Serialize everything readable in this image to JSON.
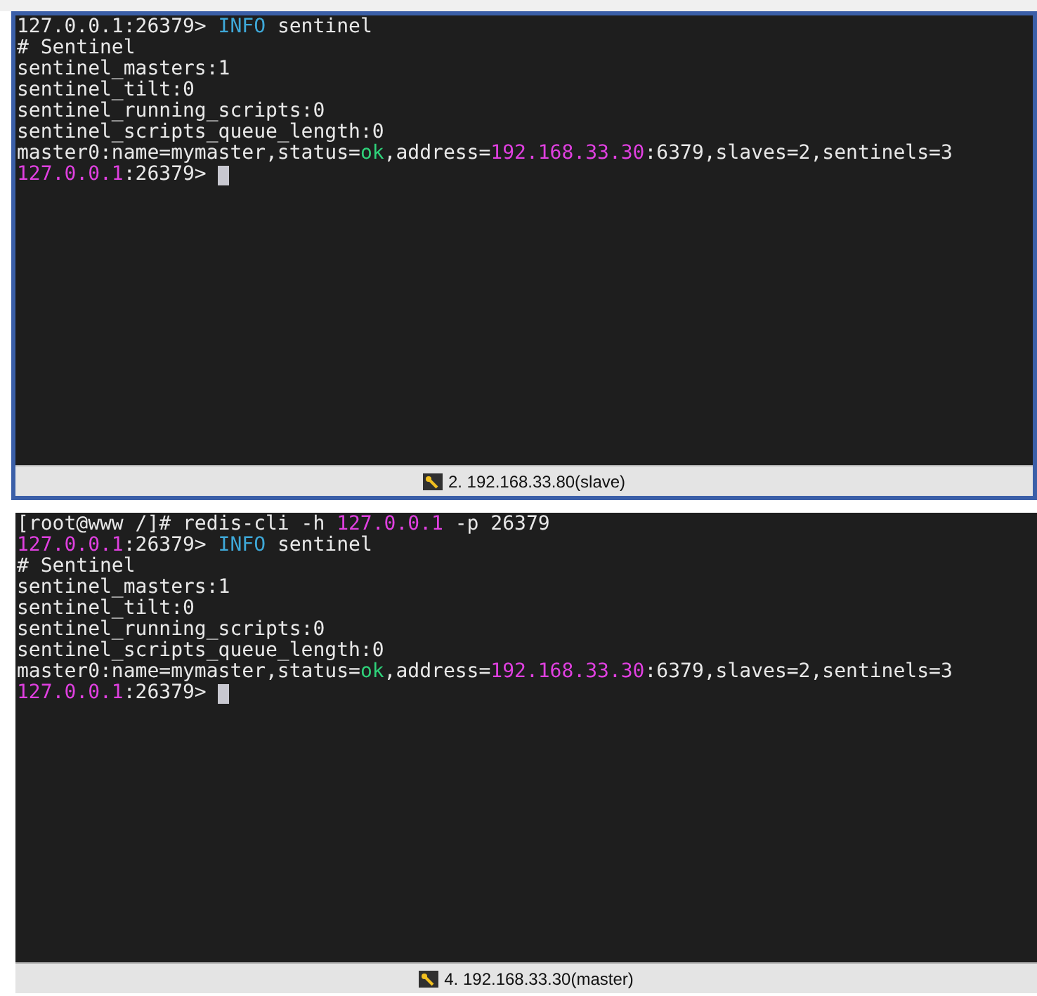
{
  "panes": [
    {
      "selected": true,
      "cursor": true,
      "title": "2. 192.168.33.80(slave)",
      "lines": [
        [
          {
            "text": "127.0.0.1:26379> ",
            "color": "#e8e8e8"
          },
          {
            "text": "INFO",
            "color": "#3ea8d8"
          },
          {
            "text": " sentinel",
            "color": "#e8e8e8"
          }
        ],
        [
          {
            "text": "# Sentinel",
            "color": "#e8e8e8"
          }
        ],
        [
          {
            "text": "sentinel_masters:1",
            "color": "#e8e8e8"
          }
        ],
        [
          {
            "text": "sentinel_tilt:0",
            "color": "#e8e8e8"
          }
        ],
        [
          {
            "text": "sentinel_running_scripts:0",
            "color": "#e8e8e8"
          }
        ],
        [
          {
            "text": "sentinel_scripts_queue_length:0",
            "color": "#e8e8e8"
          }
        ],
        [
          {
            "text": "master0:name=mymaster,status=",
            "color": "#e8e8e8"
          },
          {
            "text": "ok",
            "color": "#2fd27a"
          },
          {
            "text": ",address=",
            "color": "#e8e8e8"
          },
          {
            "text": "192.168.33.30",
            "color": "#e040e0"
          },
          {
            "text": ":6379,slaves=2,sentinels=3",
            "color": "#e8e8e8"
          }
        ],
        [
          {
            "text": "127.0.0.1",
            "color": "#e040e0"
          },
          {
            "text": ":26379> ",
            "color": "#e8e8e8"
          }
        ]
      ]
    },
    {
      "selected": false,
      "cursor": true,
      "title": "4. 192.168.33.30(master)",
      "lines": [
        [
          {
            "text": "[root@www /]# redis-cli -h ",
            "color": "#e8e8e8"
          },
          {
            "text": "127.0.0.1",
            "color": "#e040e0"
          },
          {
            "text": " -p 26379",
            "color": "#e8e8e8"
          }
        ],
        [
          {
            "text": "127.0.0.1",
            "color": "#e040e0"
          },
          {
            "text": ":26379> ",
            "color": "#e8e8e8"
          },
          {
            "text": "INFO",
            "color": "#3ea8d8"
          },
          {
            "text": " sentinel",
            "color": "#e8e8e8"
          }
        ],
        [
          {
            "text": "# Sentinel",
            "color": "#e8e8e8"
          }
        ],
        [
          {
            "text": "sentinel_masters:1",
            "color": "#e8e8e8"
          }
        ],
        [
          {
            "text": "sentinel_tilt:0",
            "color": "#e8e8e8"
          }
        ],
        [
          {
            "text": "sentinel_running_scripts:0",
            "color": "#e8e8e8"
          }
        ],
        [
          {
            "text": "sentinel_scripts_queue_length:0",
            "color": "#e8e8e8"
          }
        ],
        [
          {
            "text": "master0:name=mymaster,status=",
            "color": "#e8e8e8"
          },
          {
            "text": "ok",
            "color": "#2fd27a"
          },
          {
            "text": ",address=",
            "color": "#e8e8e8"
          },
          {
            "text": "192.168.33.30",
            "color": "#e040e0"
          },
          {
            "text": ":6379,slaves=2,sentinels=3",
            "color": "#e8e8e8"
          }
        ],
        [
          {
            "text": "127.0.0.1",
            "color": "#e040e0"
          },
          {
            "text": ":26379> ",
            "color": "#e8e8e8"
          }
        ]
      ]
    }
  ]
}
